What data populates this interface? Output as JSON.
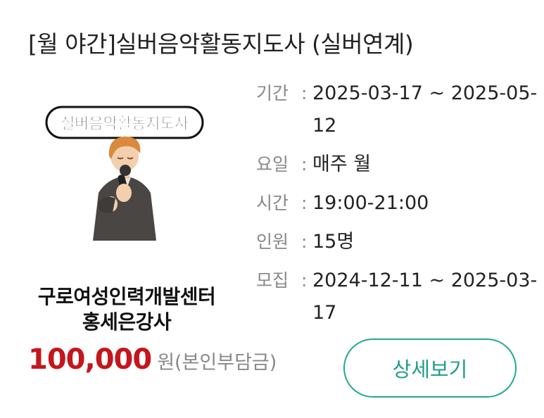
{
  "program": {
    "title": "[월 야간]실버음악활동지도사 (실버연계)",
    "thumbnail_caption": "실버음악활동지도사",
    "organization_line1": "구로여성인력개발센터",
    "organization_line2": "홍세은강사",
    "price": "100,000",
    "price_suffix": "원(본인부담금)"
  },
  "info": [
    {
      "label": "기간",
      "colon": ":",
      "value": "2025-03-17 ~ 2025-05-12"
    },
    {
      "label": "요일",
      "colon": ":",
      "value": "매주 월"
    },
    {
      "label": "시간",
      "colon": ":",
      "value": "19:00-21:00"
    },
    {
      "label": "인원",
      "colon": ":",
      "value": "15명"
    },
    {
      "label": "모집",
      "colon": ":",
      "value": "2024-12-11 ~ 2025-03-17"
    }
  ],
  "actions": {
    "detail_label": "상세보기"
  },
  "colors": {
    "price": "#c4161c",
    "accent": "#22a894",
    "label_gray": "#888888"
  }
}
